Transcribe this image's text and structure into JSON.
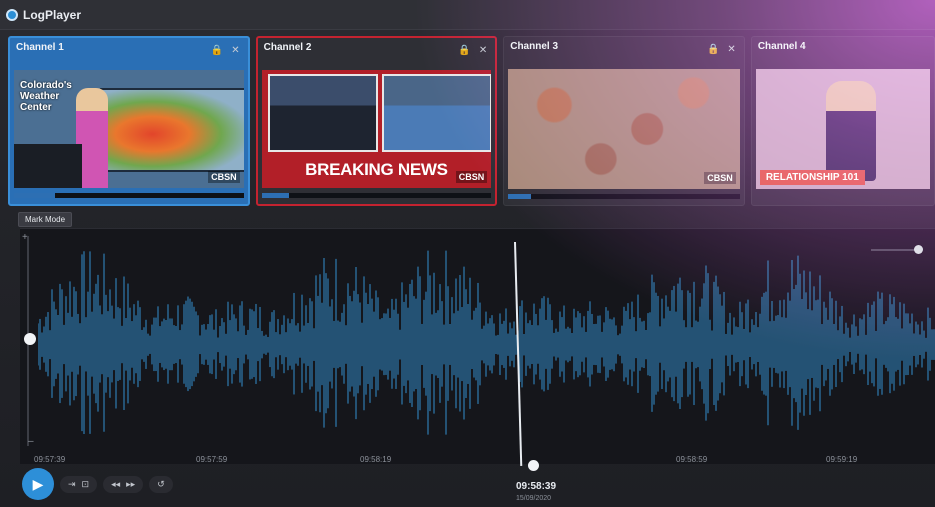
{
  "app": {
    "title": "LogPlayer"
  },
  "channels": [
    {
      "name": "Channel 1",
      "video_variant": "weather",
      "overlay_title": "Colorado's Weather Center",
      "network": "CBSN",
      "progress": 0.18
    },
    {
      "name": "Channel 2",
      "video_variant": "breaking",
      "headline": "BREAKING NEWS",
      "network": "CBSN",
      "progress": 0.12
    },
    {
      "name": "Channel 3",
      "video_variant": "flood",
      "network": "CBSN",
      "progress": 0.1
    },
    {
      "name": "Channel 4",
      "video_variant": "relationship",
      "lower_third": "RELATIONSHIP 101",
      "progress": 0.0
    }
  ],
  "toolbar": {
    "mark_mode_label": "Mark Mode"
  },
  "waveform": {
    "color": "#2b6c9a",
    "bg": "#15161b"
  },
  "timeline": {
    "ticks": [
      "09:57:39",
      "09:57:59",
      "09:58:19",
      "09:58:39",
      "09:58:59",
      "09:59:19"
    ],
    "current_time": "09:58:39",
    "current_date": "15/09/2020"
  },
  "volume": {
    "level": 0.5
  },
  "icons": {
    "lock": "lock-icon",
    "close": "close-icon",
    "play": "play-icon"
  },
  "colors": {
    "accent": "#2d8fd8",
    "breaking_red": "#c42330",
    "glow": "#bb46c8"
  }
}
